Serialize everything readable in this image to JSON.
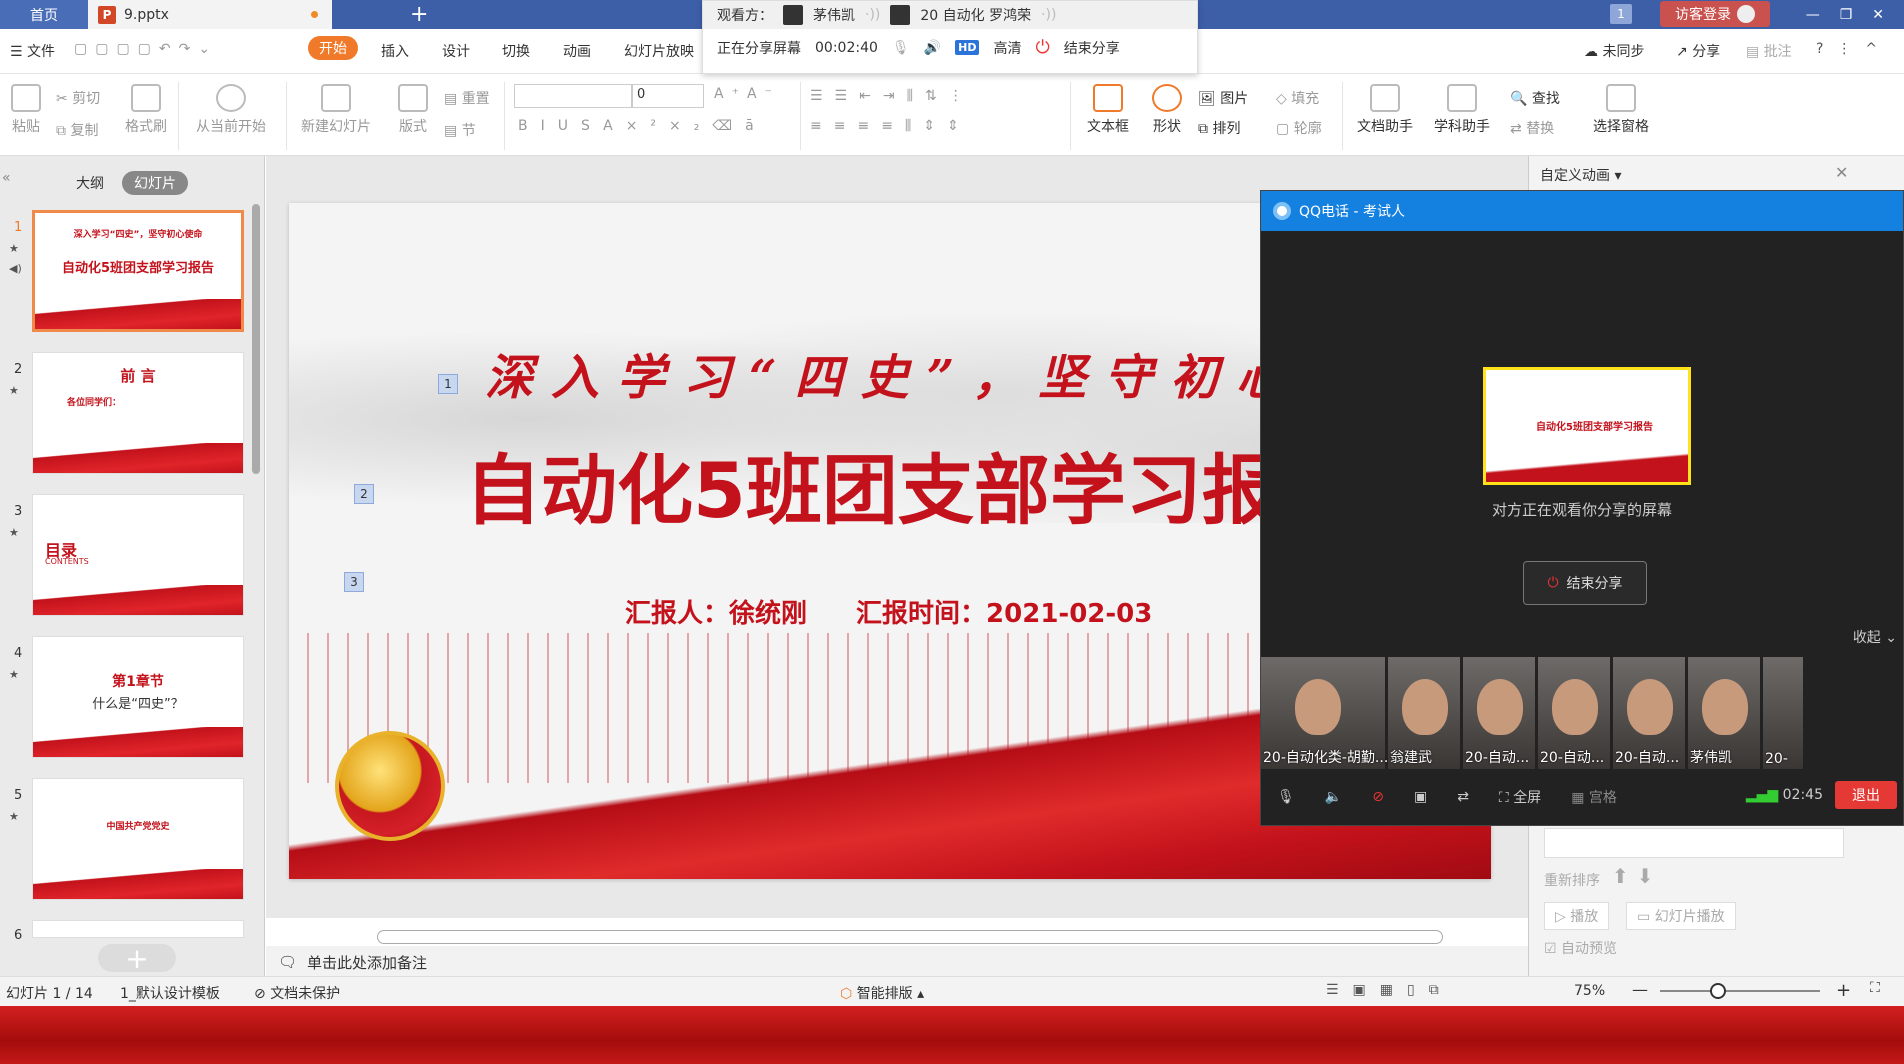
{
  "tabs": {
    "home": "首页",
    "file": "9.pptx",
    "plus": "+"
  },
  "window": {
    "visitor": "访客登录",
    "badge": "1"
  },
  "share": {
    "viewers_label": "观看方：",
    "viewer1": "茅伟凯",
    "viewer2": "20 自动化 罗鸿荣",
    "status": "正在分享屏幕",
    "timer": "00:02:40",
    "quality": "高清",
    "hd": "HD",
    "end": "结束分享"
  },
  "menu": {
    "file": "文件",
    "items": [
      "开始",
      "插入",
      "设计",
      "切换",
      "动画",
      "幻灯片放映"
    ],
    "right": {
      "sync": "未同步",
      "share": "分享",
      "comment": "批注"
    }
  },
  "ribbon": {
    "paste": "粘贴",
    "cut": "剪切",
    "copy": "复制",
    "format_painter": "格式刷",
    "play_current": "从当前开始",
    "new_slide": "新建幻灯片",
    "layout": "版式",
    "reset": "重置",
    "section": "节",
    "font_size": "0",
    "textbox": "文本框",
    "shape": "形状",
    "picture": "图片",
    "fill": "填充",
    "arrange": "排列",
    "outline": "轮廓",
    "doc_assist": "文档助手",
    "subject_assist": "学科助手",
    "find": "查找",
    "replace": "替换",
    "select_pane": "选择窗格"
  },
  "left_panel": {
    "tab_outline": "大纲",
    "tab_slides": "幻灯片",
    "slides": [
      {
        "num": "1",
        "title": "自动化5班团支部学习报告",
        "sub": "深入学习“四史”，坚守初心使命"
      },
      {
        "num": "2",
        "title": "前 言",
        "sub": "各位同学们："
      },
      {
        "num": "3",
        "title": "目录",
        "sub": "CONTENTS"
      },
      {
        "num": "4",
        "title": "第1章节",
        "sub": "什么是“四史”？"
      },
      {
        "num": "5",
        "title": "中国共产党党史",
        "sub": ""
      },
      {
        "num": "6",
        "title": "",
        "sub": ""
      }
    ]
  },
  "slide": {
    "subtitle": "深入学习“四史”，坚守初心",
    "title": "自动化5班团支部学习报",
    "meta": "汇报人：徐统刚 汇报时间：2021-02-03",
    "tags": [
      "1",
      "2",
      "3"
    ]
  },
  "notes": "单击此处添加备注",
  "right_panel": {
    "title": "自定义动画",
    "reorder": "重新排序",
    "play": "播放",
    "slideshow": "幻灯片播放",
    "autopreview": "自动预览"
  },
  "qq": {
    "title": "QQ电话 - 考试人",
    "watching": "对方正在观看你分享的屏幕",
    "end_share": "结束分享",
    "collapse": "收起",
    "participants": [
      "20-自动化类-胡勤...",
      "翁建武",
      "20-自动...",
      "20-自动...",
      "20-自动...",
      "茅伟凯",
      "20-"
    ],
    "fullscreen": "全屏",
    "grid": "宫格",
    "time": "02:45",
    "exit": "退出"
  },
  "status": {
    "slide_index": "幻灯片 1 / 14",
    "template": "1_默认设计模板",
    "protect": "文档未保护",
    "smart": "智能排版",
    "zoom": "75%"
  }
}
